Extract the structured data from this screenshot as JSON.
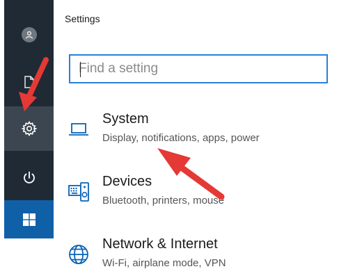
{
  "header": {
    "title": "Settings"
  },
  "search": {
    "placeholder": "Find a setting"
  },
  "categories": [
    {
      "name": "System",
      "desc": "Display, notifications, apps, power",
      "icon": "laptop-icon"
    },
    {
      "name": "Devices",
      "desc": "Bluetooth, printers, mouse",
      "icon": "devices-icon"
    },
    {
      "name": "Network & Internet",
      "desc": "Wi-Fi, airplane mode, VPN",
      "icon": "globe-icon"
    }
  ],
  "rail": {
    "icons": [
      "user-icon",
      "document-icon",
      "gear-icon",
      "power-icon",
      "windows-logo-icon"
    ]
  },
  "colors": {
    "rail": "#1f2a35",
    "rail_selected": "#3b4651",
    "start": "#1060a8",
    "accent": "#2a7fd8",
    "icon_blue": "#0a63b5",
    "annotation_arrow": "#e53935"
  }
}
